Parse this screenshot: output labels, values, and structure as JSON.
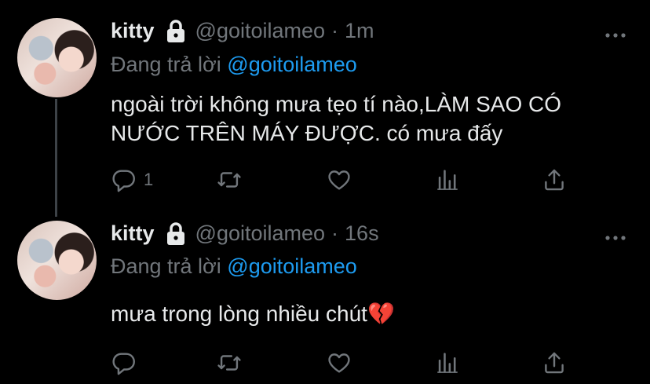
{
  "tweets": [
    {
      "name": "kitty",
      "handle": "@goitoilameo",
      "separator": "·",
      "time": "1m",
      "reply_prefix": "Đang trả lời",
      "reply_to": "@goitoilameo",
      "text": "ngoài trời không mưa tẹo tí nào,LÀM SAO CÓ NƯỚC TRÊN MÁY ĐƯỢC. có mưa đấy",
      "reply_count": "1",
      "icons": [
        "lock-icon",
        "more-icon",
        "reply-icon",
        "retweet-icon",
        "like-icon",
        "stats-icon",
        "share-icon"
      ]
    },
    {
      "name": "kitty",
      "handle": "@goitoilameo",
      "separator": "·",
      "time": "16s",
      "reply_prefix": "Đang trả lời",
      "reply_to": "@goitoilameo",
      "text": "mưa trong lòng nhiều chút💔",
      "reply_count": "",
      "icons": [
        "lock-icon",
        "more-icon",
        "reply-icon",
        "retweet-icon",
        "like-icon",
        "stats-icon",
        "share-icon"
      ]
    }
  ],
  "colors": {
    "background": "#000000",
    "text": "#e7e9ea",
    "muted": "#71767b",
    "accent": "#1d9bf0",
    "thread_line": "#3d4247"
  }
}
